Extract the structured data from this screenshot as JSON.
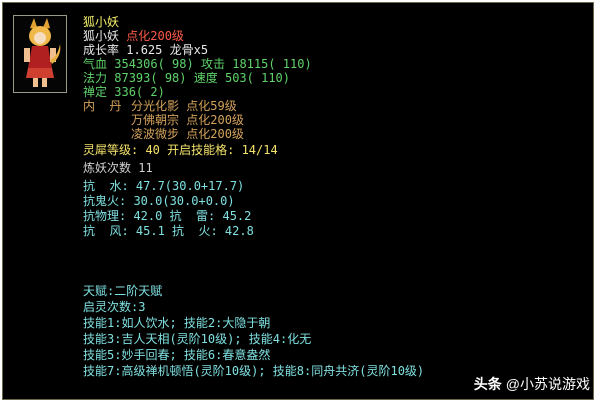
{
  "pet": {
    "title": "狐小妖",
    "name": "狐小妖",
    "name_suffix": "点化200级",
    "growth_label": "成长率",
    "growth_value": "1.625 龙骨x5",
    "hp_label": "气血",
    "hp_value": "354306( 98)",
    "atk_label": "攻击",
    "atk_value": "18115( 110)",
    "mp_label": "法力",
    "mp_value": "87393( 98)",
    "spd_label": "速度",
    "spd_value": "503( 110)",
    "calm_label": "禅定",
    "calm_value": "336( 2)",
    "dan_label": "内  丹",
    "dan_items": [
      {
        "name": "分光化影",
        "level": "点化59级"
      },
      {
        "name": "万佛朝宗",
        "level": "点化200级"
      },
      {
        "name": "凌波微步",
        "level": "点化200级"
      }
    ],
    "spirit_line": "灵犀等级: 40 开启技能格: 14/14",
    "refine_line": "炼妖次数 11",
    "resist": [
      "抗  水: 47.7(30.0+17.7)",
      "抗鬼火: 30.0(30.0+0.0)",
      "抗物理: 42.0 抗  雷: 45.2",
      "抗  风: 45.1 抗  火: 42.8"
    ],
    "talent": "天赋:二阶天赋",
    "awaken": "启灵次数:3",
    "skills": [
      "技能1:如人饮水; 技能2:大隐于朝",
      "技能3:吉人天相(灵阶10级); 技能4:化无",
      "技能5:妙手回春; 技能6:春意盎然",
      "技能7:高级禅机顿悟(灵阶10级); 技能8:同舟共济(灵阶10级)"
    ]
  },
  "watermark": {
    "logo": "头条",
    "handle": "@小苏说游戏"
  },
  "colors": {
    "panel_bg": "#000000",
    "yellow": "#f5e36a",
    "green": "#5fd36a",
    "red": "#ff5a4a",
    "cyan": "#7fe0e0"
  }
}
